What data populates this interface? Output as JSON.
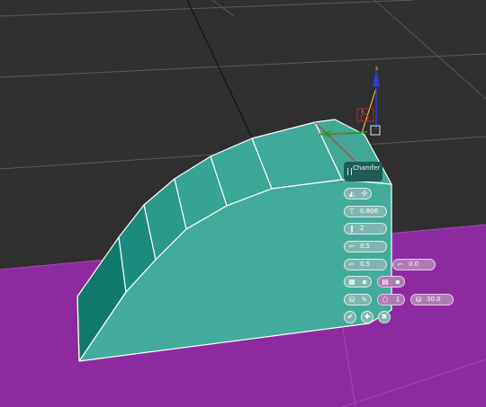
{
  "caddy": {
    "title": "Chamfer",
    "rows": [
      {
        "icons": [
          "chamfer-type-icon",
          "pin-icon"
        ],
        "value": ""
      },
      {
        "icon": "amount-icon",
        "value": "0.806"
      },
      {
        "icon": "segments-icon",
        "value": "2"
      },
      {
        "icon": "tension-icon",
        "value": "0.5"
      },
      {
        "icon": "depth-icon",
        "value": "0.5",
        "extra_icon": "inset-icon",
        "extra_value": "0.0"
      },
      {
        "icons": [
          "mitering-icon",
          "end-bias-icon"
        ],
        "extra_icons": [
          "radius-icon",
          "smooth-icon"
        ]
      },
      {
        "icons": [
          "open-icon",
          "tool-icon"
        ],
        "extra_icons": [
          "smoothing-icon",
          "threshold-icon"
        ],
        "extra_value": "30.0"
      }
    ],
    "actions": [
      "ok-icon",
      "apply-icon",
      "cancel-icon"
    ]
  },
  "gizmo": {
    "axis_z": "z",
    "axis_y": "y",
    "axis_x": "x"
  },
  "colors": {
    "viewport_bg": "#2f2f2f",
    "ground": "#8e2aa0",
    "mesh": "#3fa596",
    "caddy": "#7fb7b0"
  }
}
